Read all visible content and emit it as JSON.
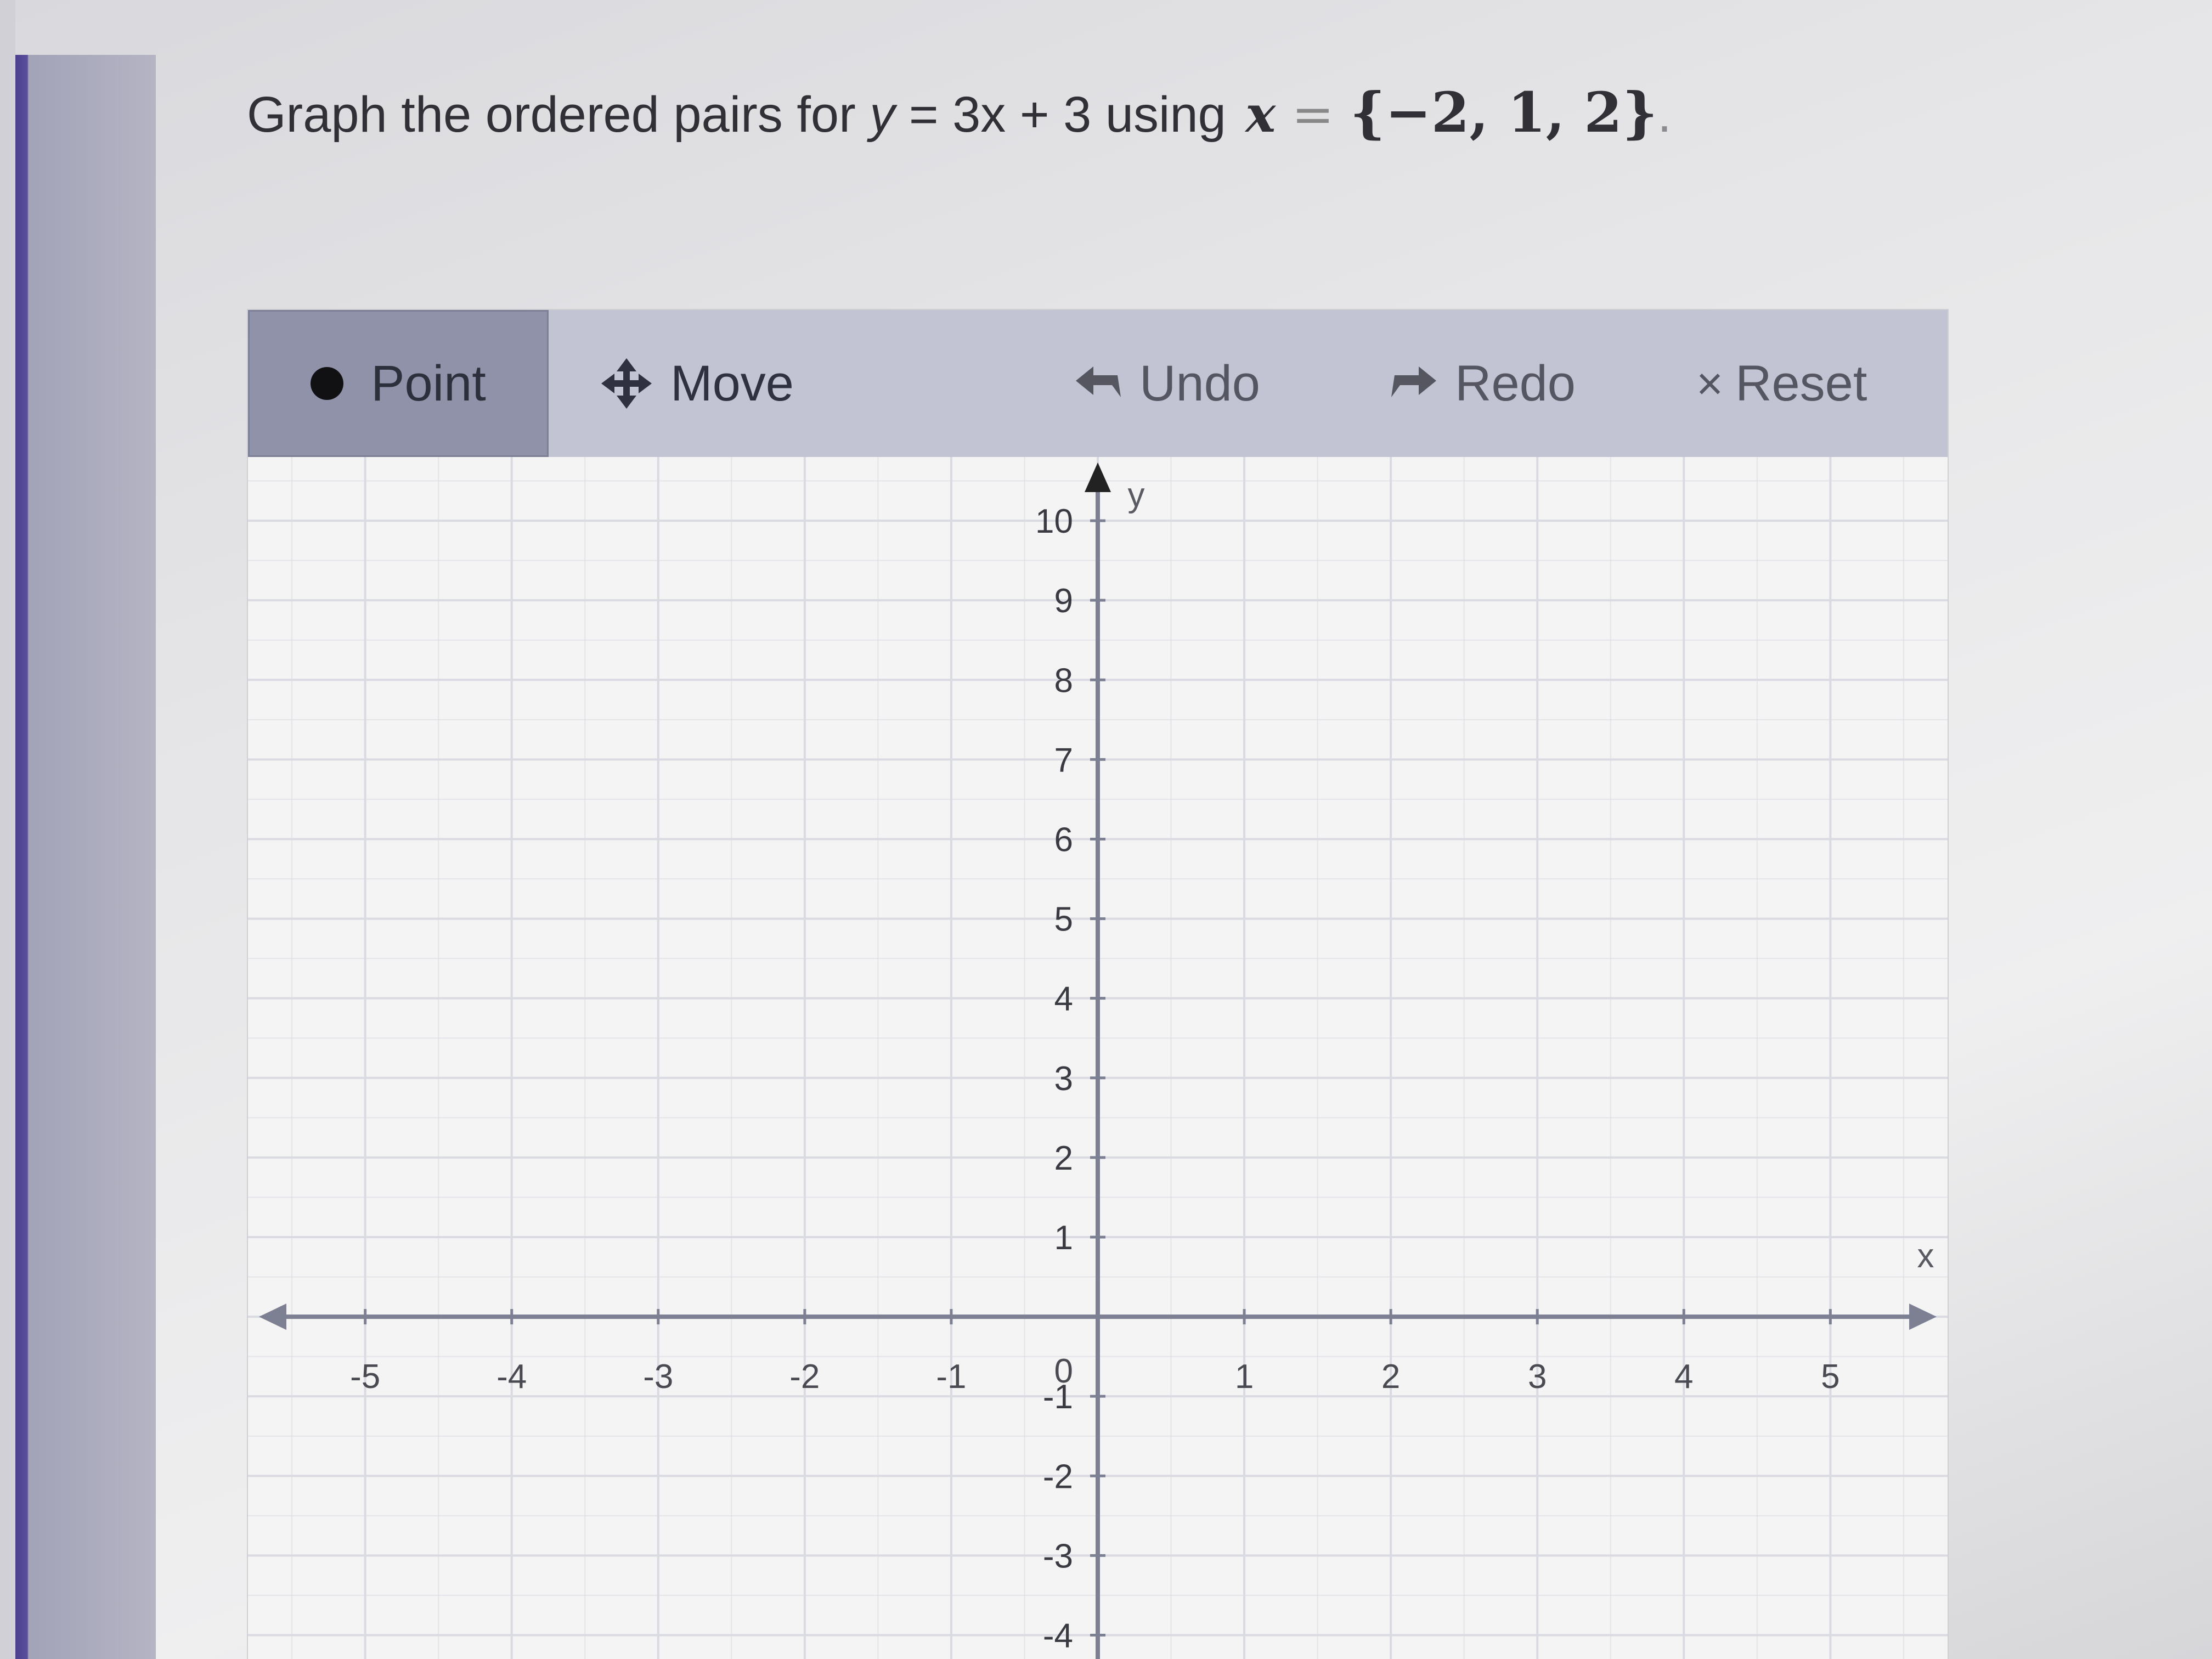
{
  "question": {
    "prefix": "Graph the ordered pairs for ",
    "y_var": "y",
    "equation_rest": " = 3x + 3 using ",
    "x_var": "x",
    "equals": " = ",
    "set": "{−2, 1, 2}",
    "period": "."
  },
  "toolbar": {
    "point_label": "Point",
    "move_label": "Move",
    "undo_label": "Undo",
    "redo_label": "Redo",
    "reset_label": "Reset",
    "reset_glyph": "×",
    "active_tool": "Point",
    "icons": {
      "point": "filled-circle-icon",
      "move": "four-way-arrow-icon",
      "undo": "undo-arrow-icon",
      "redo": "redo-arrow-icon",
      "reset": "close-x-icon"
    }
  },
  "colors": {
    "toolbar_bg": "#c2c4d4",
    "active_tool_bg": "#8f92a8",
    "grid_line": "#dadae2",
    "axis": "#7d7f93",
    "text": "#303036"
  },
  "chart_data": {
    "type": "scatter",
    "title": "",
    "xlabel": "x",
    "ylabel": "y",
    "xlim": [
      -5.8,
      5.8
    ],
    "ylim": [
      -4.3,
      10.8
    ],
    "grid": true,
    "x_ticks": [
      -5,
      -4,
      -3,
      -2,
      -1,
      1,
      2,
      3,
      4,
      5
    ],
    "y_ticks": [
      -4,
      -3,
      -2,
      -1,
      1,
      2,
      3,
      4,
      5,
      6,
      7,
      8,
      9,
      10
    ],
    "origin_label": "0",
    "points": []
  }
}
